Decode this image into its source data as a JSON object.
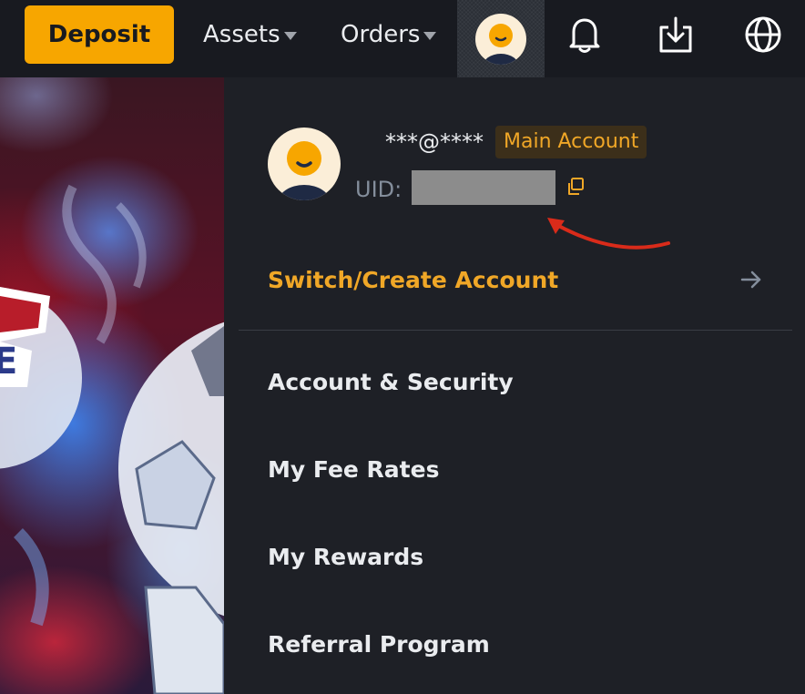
{
  "topbar": {
    "deposit_label": "Deposit",
    "nav": [
      {
        "label": "Assets"
      },
      {
        "label": "Orders"
      }
    ],
    "icons": [
      "user-avatar-icon",
      "bell-icon",
      "download-icon",
      "globe-icon"
    ]
  },
  "account_panel": {
    "email": "***@****",
    "badge": "Main Account",
    "uid_label": "UID:",
    "uid_value": "",
    "switch_label": "Switch/Create Account",
    "menu": [
      {
        "label": "Account & Security"
      },
      {
        "label": "My Fee Rates"
      },
      {
        "label": "My Rewards"
      },
      {
        "label": "Referral Program"
      }
    ]
  },
  "colors": {
    "accent": "#f7a600",
    "background": "#181a20",
    "panel": "#1e2026",
    "annotation": "#d92b1a"
  }
}
